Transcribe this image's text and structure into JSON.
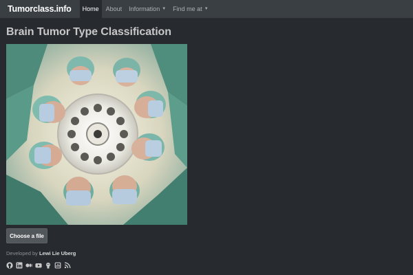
{
  "navbar": {
    "brand": "Tumorclass.info",
    "items": [
      {
        "label": "Home",
        "active": true,
        "dropdown": false
      },
      {
        "label": "About",
        "active": false,
        "dropdown": false
      },
      {
        "label": "Information",
        "active": false,
        "dropdown": true
      },
      {
        "label": "Find me at",
        "active": false,
        "dropdown": true
      }
    ]
  },
  "main": {
    "title": "Brain Tumor Type Classification",
    "upload_button": "Choose a file"
  },
  "footer": {
    "developed_prefix": "Developed by",
    "developer": "Lewi Lie Uberg",
    "socials": [
      "github-icon",
      "linkedin-icon",
      "medium-icon",
      "youtube-icon",
      "kaggle-icon",
      "podcast-icon",
      "rss-icon"
    ]
  },
  "colors": {
    "background": "#272b30",
    "navbar": "#3a3f44",
    "button": "#52575c"
  }
}
